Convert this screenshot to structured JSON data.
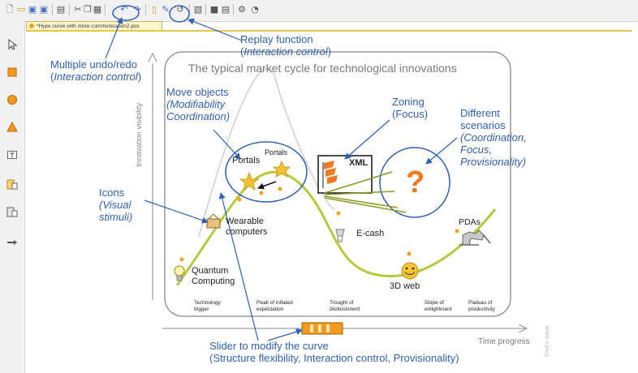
{
  "toolbar": {
    "icons": [
      "new-icon",
      "open-icon",
      "save-icon",
      "save-as-icon",
      "print-icon",
      "cut-icon",
      "copy-icon",
      "paste-icon",
      "undo-icon",
      "redo-icon",
      "page-icon",
      "edit-icon",
      "replay-icon",
      "image-icon",
      "layer-icon",
      "layer2-icon",
      "settings-icon",
      "info-icon"
    ]
  },
  "document_tab": {
    "title": "*Hype curve with more communication2.pos"
  },
  "palette": {
    "tools": [
      "select-tool",
      "rectangle-tool",
      "circle-tool",
      "triangle-tool",
      "text-tool",
      "insert-image-tool",
      "insert-object-tool",
      "connector-tool"
    ]
  },
  "figure": {
    "title": "The typical market cycle for technological innovations",
    "y_axis": "Innovation visibility",
    "x_axis": "Time progress",
    "phases": [
      [
        "Technology",
        "trigger"
      ],
      [
        "Peak of  inflated",
        "expectation"
      ],
      [
        "Trought of",
        "disillusionent"
      ],
      [
        "Slope of",
        "enlightment"
      ],
      [
        "Plateau of",
        "productivity"
      ]
    ],
    "items": {
      "portals_1": "Portals",
      "portals_2": "Portals",
      "xml": "XML",
      "wearable_1": "Wearable",
      "wearable_2": "computers",
      "ecash": "E-cash",
      "pdas": "PDAs",
      "quantum_1": "Quantum",
      "quantum_2": "Computing",
      "web3d": "3D web",
      "question": "?"
    },
    "watermark": "©Ivo's Issue"
  },
  "annotations": {
    "undo_redo": {
      "line1": "Multiple undo/redo",
      "open": "(",
      "italic": "Interaction control",
      "close": ")"
    },
    "replay": {
      "line1": "Replay function",
      "open": "(",
      "italic": "Interaction control",
      "close": ")"
    },
    "move": {
      "line1": "Move objects",
      "line2": "(Modifiability",
      "line3": "Coordination)"
    },
    "zoning": {
      "line1": "Zoning",
      "line2": "(Focus)"
    },
    "scenarios": {
      "line1": "Different",
      "line2": "scenarios",
      "line3": "(Coordination,",
      "line4": "Focus,",
      "line5": "Provisionality)"
    },
    "icons": {
      "line1": "Icons",
      "line2": "(Visual",
      "line3": "stimuli)"
    },
    "slider": {
      "line1": "Slider to modify the curve",
      "line2": "(Structure flexibility, Interaction control, Provisionality)"
    }
  },
  "colors": {
    "annotation_blue": "#2f5fb8",
    "curve": "#b7c93a",
    "slider_orange": "#f29a1e",
    "question_orange": "#f07a1e"
  }
}
